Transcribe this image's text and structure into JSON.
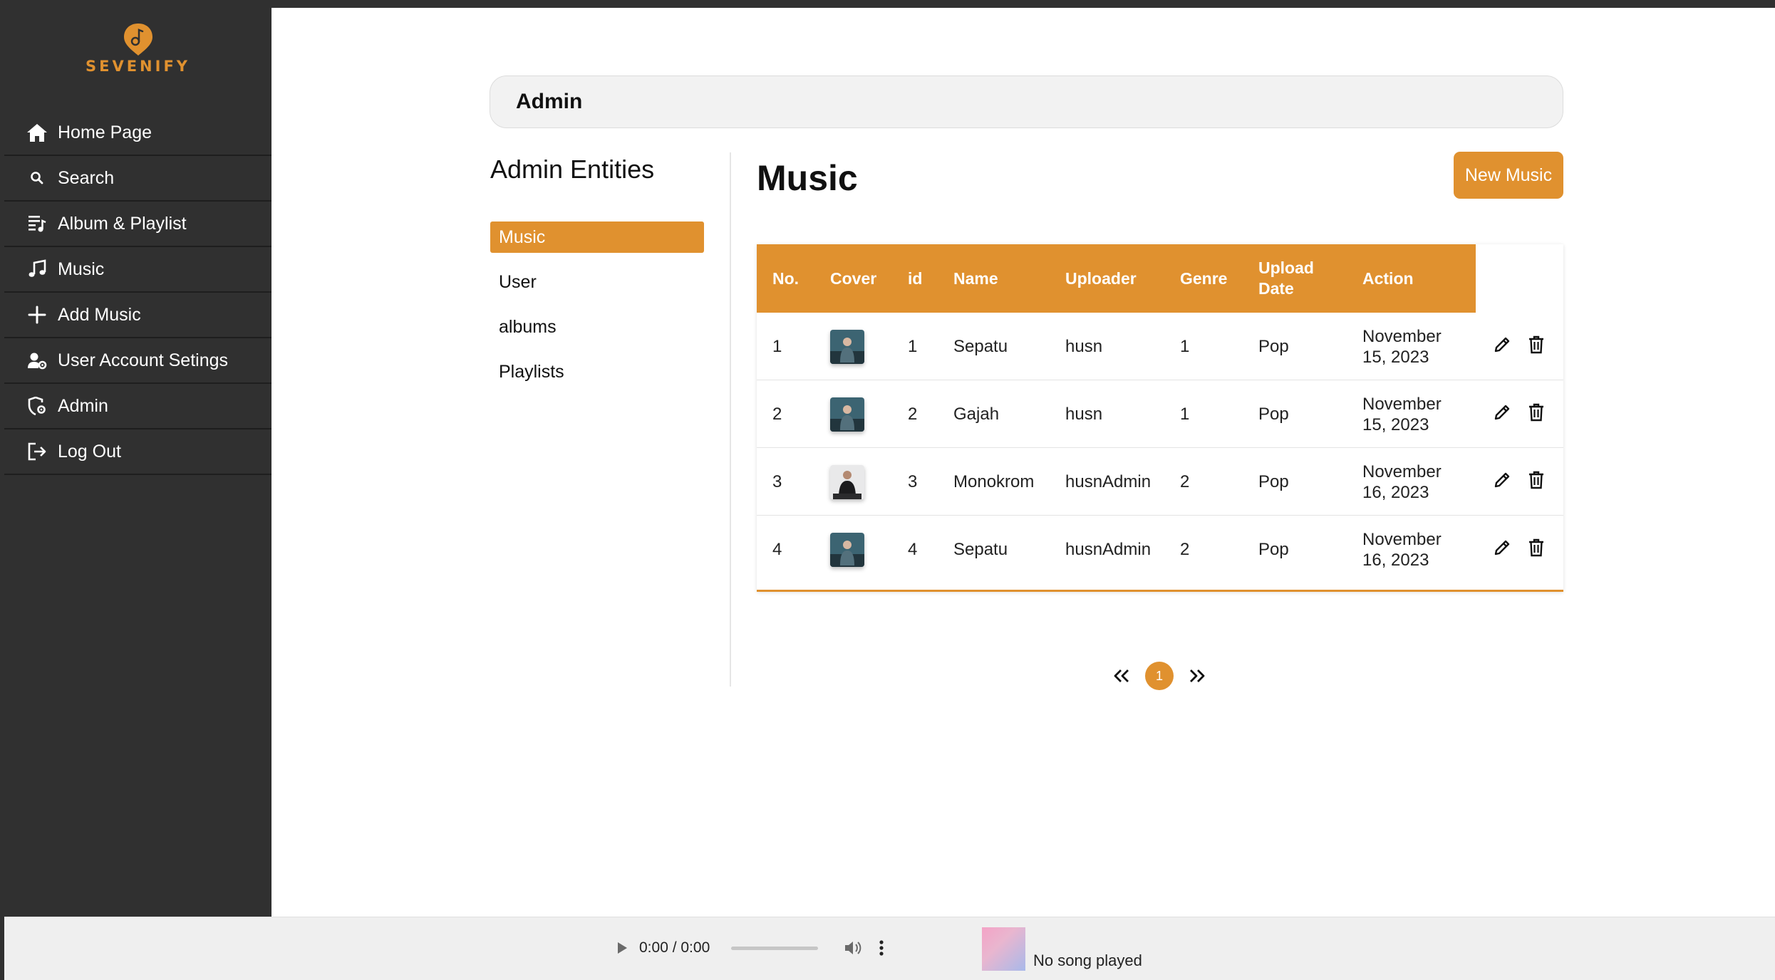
{
  "brand": {
    "name": "SEVENIFY",
    "accent": "#e0912f"
  },
  "sidebar": {
    "items": [
      {
        "label": "Home Page",
        "icon": "home-icon"
      },
      {
        "label": "Search",
        "icon": "search-icon"
      },
      {
        "label": "Album & Playlist",
        "icon": "playlist-icon"
      },
      {
        "label": "Music",
        "icon": "music-note-icon"
      },
      {
        "label": "Add Music",
        "icon": "plus-icon"
      },
      {
        "label": "User Account Setings",
        "icon": "user-gear-icon"
      },
      {
        "label": "Admin",
        "icon": "admin-shield-icon"
      },
      {
        "label": "Log Out",
        "icon": "logout-icon"
      }
    ]
  },
  "admin_bar": {
    "title": "Admin"
  },
  "entities": {
    "title": "Admin Entities",
    "items": [
      {
        "label": "Music",
        "active": true
      },
      {
        "label": "User",
        "active": false
      },
      {
        "label": "albums",
        "active": false
      },
      {
        "label": "Playlists",
        "active": false
      }
    ]
  },
  "main": {
    "title": "Music",
    "new_button": "New Music"
  },
  "table": {
    "columns": [
      "No.",
      "Cover",
      "id",
      "Name",
      "Uploader",
      "Genre",
      "Upload Date",
      "Action"
    ],
    "rows": [
      {
        "no": "1",
        "id": "1",
        "name": "Sepatu",
        "uploader": "husn",
        "genre_id": "1",
        "genre": "Pop",
        "date": "November 15, 2023"
      },
      {
        "no": "2",
        "id": "2",
        "name": "Gajah",
        "uploader": "husn",
        "genre_id": "1",
        "genre": "Pop",
        "date": "November 15, 2023"
      },
      {
        "no": "3",
        "id": "3",
        "name": "Monokrom",
        "uploader": "husnAdmin",
        "genre_id": "2",
        "genre": "Pop",
        "date": "November 16, 2023"
      },
      {
        "no": "4",
        "id": "4",
        "name": "Sepatu",
        "uploader": "husnAdmin",
        "genre_id": "2",
        "genre": "Pop",
        "date": "November 16, 2023"
      }
    ]
  },
  "pagination": {
    "current": "1",
    "prev": "«",
    "next": "»"
  },
  "player": {
    "time": "0:00 / 0:00",
    "now_playing": "No song played"
  }
}
